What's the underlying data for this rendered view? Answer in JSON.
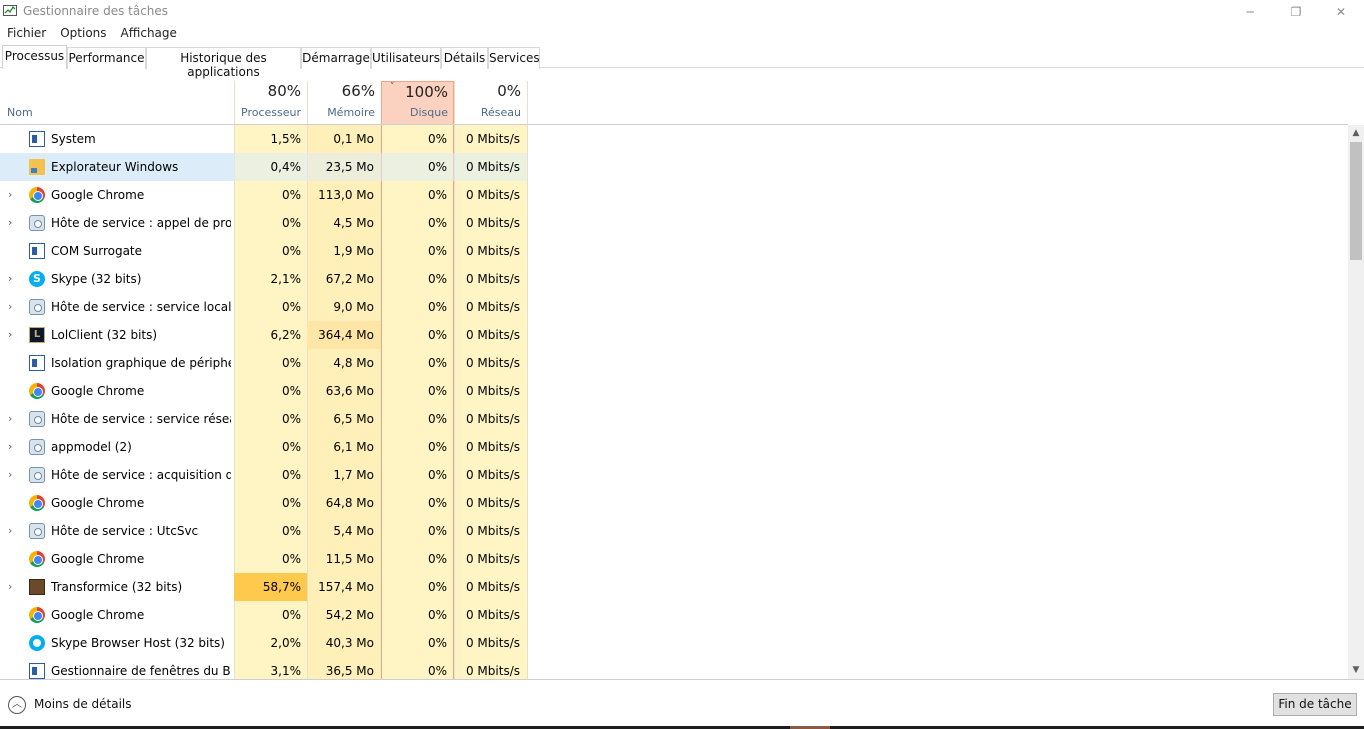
{
  "window": {
    "title": "Gestionnaire des tâches",
    "app_icon": "task-manager-icon",
    "controls": {
      "minimize": "─",
      "maximize": "❐",
      "close": "✕"
    }
  },
  "menu": [
    "Fichier",
    "Options",
    "Affichage"
  ],
  "tabs": [
    {
      "label": "Processus",
      "active": true
    },
    {
      "label": "Performance",
      "active": false
    },
    {
      "label": "Historique des applications",
      "active": false
    },
    {
      "label": "Démarrage",
      "active": false
    },
    {
      "label": "Utilisateurs",
      "active": false
    },
    {
      "label": "Détails",
      "active": false
    },
    {
      "label": "Services",
      "active": false
    }
  ],
  "columns": {
    "name": "Nom",
    "cpu": {
      "pct": "80%",
      "label": "Processeur"
    },
    "mem": {
      "pct": "66%",
      "label": "Mémoire"
    },
    "disk": {
      "pct": "100%",
      "label": "Disque",
      "sorted": true,
      "sort_glyph": "˅"
    },
    "net": {
      "pct": "0%",
      "label": "Réseau"
    }
  },
  "processes": [
    {
      "name": "System",
      "icon": "system-icon",
      "expandable": false,
      "cpu": "1,5%",
      "mem": "0,1 Mo",
      "disk": "0%",
      "net": "0 Mbits/s"
    },
    {
      "name": "Explorateur Windows",
      "icon": "explorer-icon",
      "expandable": false,
      "selected": true,
      "cpu": "0,4%",
      "mem": "23,5 Mo",
      "disk": "0%",
      "net": "0 Mbits/s"
    },
    {
      "name": "Google Chrome",
      "icon": "chrome-icon",
      "expandable": true,
      "cpu": "0%",
      "mem": "113,0 Mo",
      "disk": "0%",
      "net": "0 Mbits/s"
    },
    {
      "name": "Hôte de service : appel de procé...",
      "icon": "service-host-icon",
      "expandable": true,
      "cpu": "0%",
      "mem": "4,5 Mo",
      "disk": "0%",
      "net": "0 Mbits/s"
    },
    {
      "name": "COM Surrogate",
      "icon": "system-icon",
      "expandable": false,
      "cpu": "0%",
      "mem": "1,9 Mo",
      "disk": "0%",
      "net": "0 Mbits/s"
    },
    {
      "name": "Skype (32 bits)",
      "icon": "skype-icon",
      "expandable": true,
      "cpu": "2,1%",
      "mem": "67,2 Mo",
      "disk": "0%",
      "net": "0 Mbits/s"
    },
    {
      "name": "Hôte de service : service local (r...",
      "icon": "service-host-icon",
      "expandable": true,
      "cpu": "0%",
      "mem": "9,0 Mo",
      "disk": "0%",
      "net": "0 Mbits/s"
    },
    {
      "name": "LolClient (32 bits)",
      "icon": "lolclient-icon",
      "expandable": true,
      "cpu": "6,2%",
      "mem": "364,4 Mo",
      "disk": "0%",
      "net": "0 Mbits/s"
    },
    {
      "name": "Isolation graphique de périphéri...",
      "icon": "system-icon",
      "expandable": false,
      "cpu": "0%",
      "mem": "4,8 Mo",
      "disk": "0%",
      "net": "0 Mbits/s"
    },
    {
      "name": "Google Chrome",
      "icon": "chrome-icon",
      "expandable": false,
      "cpu": "0%",
      "mem": "63,6 Mo",
      "disk": "0%",
      "net": "0 Mbits/s"
    },
    {
      "name": "Hôte de service : service réseau ...",
      "icon": "service-host-icon",
      "expandable": true,
      "cpu": "0%",
      "mem": "6,5 Mo",
      "disk": "0%",
      "net": "0 Mbits/s"
    },
    {
      "name": "appmodel (2)",
      "icon": "service-host-icon",
      "expandable": true,
      "cpu": "0%",
      "mem": "6,1 Mo",
      "disk": "0%",
      "net": "0 Mbits/s"
    },
    {
      "name": "Hôte de service : acquisition d'i...",
      "icon": "service-host-icon",
      "expandable": true,
      "cpu": "0%",
      "mem": "1,7 Mo",
      "disk": "0%",
      "net": "0 Mbits/s"
    },
    {
      "name": "Google Chrome",
      "icon": "chrome-icon",
      "expandable": false,
      "cpu": "0%",
      "mem": "64,8 Mo",
      "disk": "0%",
      "net": "0 Mbits/s"
    },
    {
      "name": "Hôte de service : UtcSvc",
      "icon": "service-host-icon",
      "expandable": true,
      "cpu": "0%",
      "mem": "5,4 Mo",
      "disk": "0%",
      "net": "0 Mbits/s"
    },
    {
      "name": "Google Chrome",
      "icon": "chrome-icon",
      "expandable": false,
      "cpu": "0%",
      "mem": "11,5 Mo",
      "disk": "0%",
      "net": "0 Mbits/s"
    },
    {
      "name": "Transformice (32 bits)",
      "icon": "transformice-icon",
      "expandable": true,
      "cpu": "58,7%",
      "cpu_high": true,
      "mem": "157,4 Mo",
      "disk": "0%",
      "net": "0 Mbits/s"
    },
    {
      "name": "Google Chrome",
      "icon": "chrome-icon",
      "expandable": false,
      "cpu": "0%",
      "mem": "54,2 Mo",
      "disk": "0%",
      "net": "0 Mbits/s"
    },
    {
      "name": "Skype Browser Host (32 bits)",
      "icon": "skype-browser-icon",
      "expandable": false,
      "cpu": "2,0%",
      "mem": "40,3 Mo",
      "disk": "0%",
      "net": "0 Mbits/s"
    },
    {
      "name": "Gestionnaire de fenêtres du Bur...",
      "icon": "system-icon",
      "expandable": false,
      "cpu": "3,1%",
      "mem": "36,5 Mo",
      "disk": "0%",
      "net": "0 Mbits/s"
    }
  ],
  "footer": {
    "less_details_label": "Moins de détails",
    "end_task_label": "Fin de tâche"
  },
  "colors": {
    "heat_low": "#fff4c4",
    "heat_mid": "#ffe6a6",
    "heat_high": "#ffc94d",
    "sorted_header": "#fbd2c0",
    "selection": "#dcecf8"
  }
}
